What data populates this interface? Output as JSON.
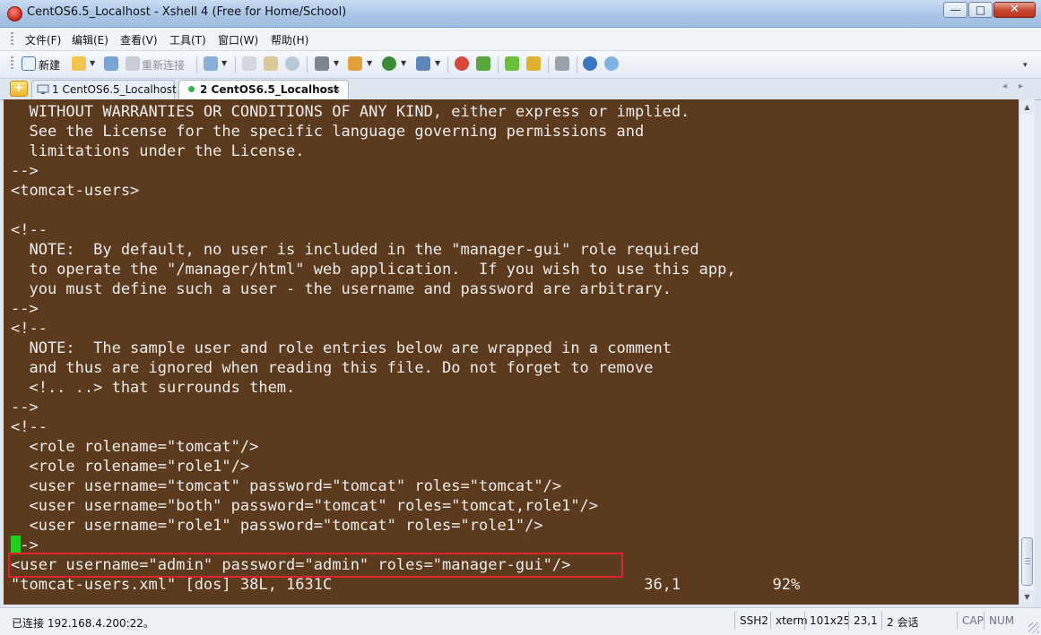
{
  "window": {
    "title": "CentOS6.5_Localhost - Xshell 4 (Free for Home/School)",
    "controls": {
      "minimize": "—",
      "maximize": "□",
      "close": "✕"
    }
  },
  "menu": {
    "items": [
      "文件(F)",
      "编辑(E)",
      "查看(V)",
      "工具(T)",
      "窗口(W)",
      "帮助(H)"
    ]
  },
  "toolbar": {
    "new_label": "新建",
    "reconnect_label": "重新连接",
    "overflow": "▾"
  },
  "tabs": [
    {
      "label": "1 CentOS6.5_Localhost",
      "active": false
    },
    {
      "label": "2 CentOS6.5_Localhost",
      "active": true
    }
  ],
  "tab_bar": {
    "add": "+",
    "close": "×",
    "nav_left": "◂",
    "nav_right": "▸"
  },
  "terminal": {
    "background": "#5c3a1e",
    "foreground": "#ececec",
    "cursor_color": "#1fd01f",
    "lines": [
      "  WITHOUT WARRANTIES OR CONDITIONS OF ANY KIND, either express or implied.",
      "  See the License for the specific language governing permissions and",
      "  limitations under the License.",
      "-->",
      "<tomcat-users>",
      "",
      "<!--",
      "  NOTE:  By default, no user is included in the \"manager-gui\" role required",
      "  to operate the \"/manager/html\" web application.  If you wish to use this app,",
      "  you must define such a user - the username and password are arbitrary.",
      "-->",
      "<!--",
      "  NOTE:  The sample user and role entries below are wrapped in a comment",
      "  and thus are ignored when reading this file. Do not forget to remove",
      "  <!.. ..> that surrounds them.",
      "-->",
      "<!--",
      "  <role rolename=\"tomcat\"/>",
      "  <role rolename=\"role1\"/>",
      "  <user username=\"tomcat\" password=\"tomcat\" roles=\"tomcat\"/>",
      "  <user username=\"both\" password=\"tomcat\" roles=\"tomcat,role1\"/>",
      "  <user username=\"role1\" password=\"tomcat\" roles=\"role1\"/>",
      "-->",
      "<user username=\"admin\" password=\"admin\" roles=\"manager-gui\"/>",
      "\"tomcat-users.xml\" [dos] 38L, 1631C                                  36,1          92%"
    ],
    "highlight_color": "#e0202a"
  },
  "status_bar": {
    "connection": "已连接 192.168.4.200:22。",
    "protocol": "SSH2",
    "terminal_type": "xterm",
    "size": "101x25",
    "cursor_pos": "23,1",
    "sessions": "2 会话",
    "caps": "CAP",
    "num": "NUM"
  }
}
